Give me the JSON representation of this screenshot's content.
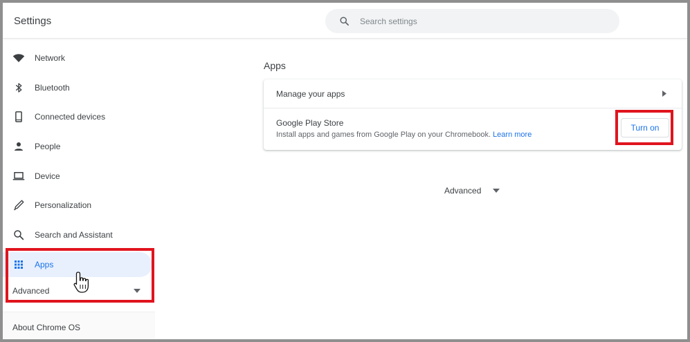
{
  "header": {
    "title": "Settings",
    "search_placeholder": "Search settings",
    "search_value": ""
  },
  "sidebar": {
    "items": [
      {
        "label": "Network",
        "icon": "wifi-icon"
      },
      {
        "label": "Bluetooth",
        "icon": "bluetooth-icon"
      },
      {
        "label": "Connected devices",
        "icon": "phone-icon"
      },
      {
        "label": "People",
        "icon": "person-icon"
      },
      {
        "label": "Device",
        "icon": "laptop-icon"
      },
      {
        "label": "Personalization",
        "icon": "pen-icon"
      },
      {
        "label": "Search and Assistant",
        "icon": "search-icon"
      },
      {
        "label": "Apps",
        "icon": "apps-grid-icon",
        "active": true
      }
    ],
    "advanced_label": "Advanced",
    "about_label": "About Chrome OS"
  },
  "main": {
    "section_title": "Apps",
    "manage_apps_label": "Manage your apps",
    "play_store": {
      "title": "Google Play Store",
      "description": "Install apps and games from Google Play on your Chromebook.",
      "learn_more": "Learn more",
      "button_label": "Turn on"
    },
    "advanced_label": "Advanced"
  },
  "colors": {
    "accent": "#1a73e8",
    "highlight_box": "#e0141e",
    "active_bg": "#e8f0fe",
    "text": "#3c4043"
  }
}
